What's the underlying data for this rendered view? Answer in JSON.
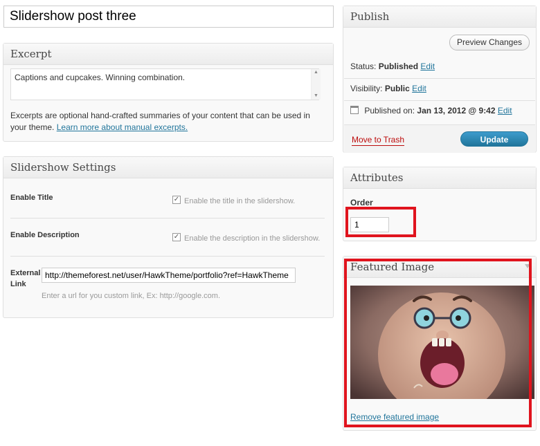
{
  "post": {
    "title": "Slidershow post three"
  },
  "excerpt": {
    "heading": "Excerpt",
    "text": "Captions and cupcakes. Winning combination.",
    "help": "Excerpts are optional hand-crafted summaries of your content that can be used in your theme.",
    "help_link": "Learn more about manual excerpts."
  },
  "slider_settings": {
    "heading": "Slidershow Settings",
    "enable_title_label": "Enable Title",
    "enable_title_hint": "Enable the title in the slidershow.",
    "enable_desc_label": "Enable Description",
    "enable_desc_hint": "Enable the description in the slidershow.",
    "external_label_line1": "External",
    "external_label_line2": "Link",
    "external_value": "http://themeforest.net/user/HawkTheme/portfolio?ref=HawkTheme",
    "external_hint": "Enter a url for you custom link, Ex: http://google.com."
  },
  "publish": {
    "heading": "Publish",
    "preview_label": "Preview Changes",
    "status_label": "Status:",
    "status_value": "Published",
    "visibility_label": "Visibility:",
    "visibility_value": "Public",
    "published_label": "Published on:",
    "published_value": "Jan 13, 2012 @ 9:42",
    "edit_label": "Edit",
    "trash_label": "Move to Trash",
    "update_label": "Update"
  },
  "attributes": {
    "heading": "Attributes",
    "order_label": "Order",
    "order_value": "1"
  },
  "featured_image": {
    "heading": "Featured Image",
    "remove_label": "Remove featured image"
  },
  "colors": {
    "highlight": "#e0141e",
    "link": "#21759b",
    "update_button": "#21759b",
    "trash": "#bc0b0b"
  }
}
